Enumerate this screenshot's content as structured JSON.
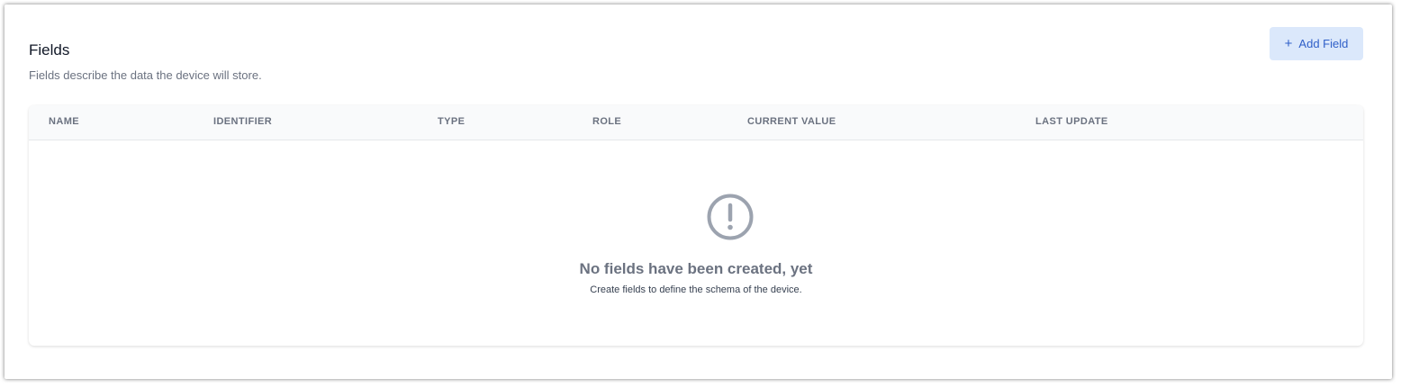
{
  "section": {
    "title": "Fields",
    "description": "Fields describe the data the device will store."
  },
  "actions": {
    "add_field_icon": "+",
    "add_field_label": "Add Field"
  },
  "table": {
    "columns": [
      "NAME",
      "IDENTIFIER",
      "TYPE",
      "ROLE",
      "CURRENT VALUE",
      "LAST UPDATE"
    ],
    "rows": []
  },
  "empty_state": {
    "icon": "exclamation-circle-icon",
    "title": "No fields have been created, yet",
    "description": "Create fields to define the schema of the device."
  },
  "colors": {
    "accent": "#2f5fc8",
    "accent_bg": "#dbe8fb",
    "muted_text": "#6b7280",
    "icon_gray": "#9ca3af"
  }
}
